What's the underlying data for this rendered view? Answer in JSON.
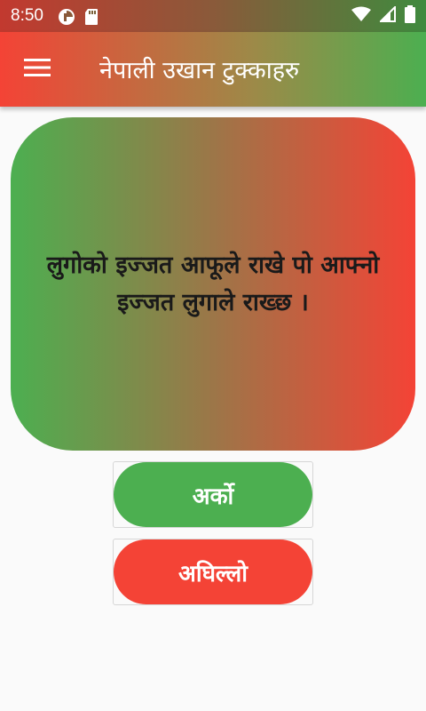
{
  "status_bar": {
    "time": "8:50",
    "left_icons": [
      "pie-icon",
      "sd-card-icon"
    ],
    "right_icons": [
      "wifi-icon",
      "signal-icon",
      "battery-icon"
    ]
  },
  "app_bar": {
    "title": "नेपाली उखान टुक्काहरु",
    "menu_icon": "hamburger-menu-icon"
  },
  "card": {
    "proverb": "लुगोको इज्जत आफूले राखे पो आफ्नो इज्जत लुगाले राख्छ ।"
  },
  "buttons": {
    "next_label": "अर्को",
    "prev_label": "अघिल्लो"
  },
  "colors": {
    "green": "#4caf50",
    "red": "#f44336"
  }
}
